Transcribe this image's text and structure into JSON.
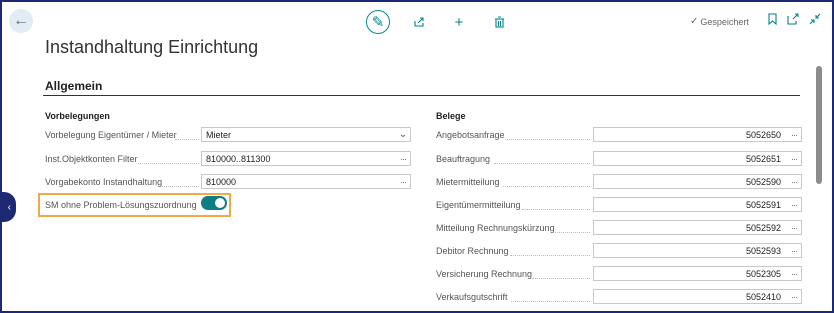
{
  "header": {
    "title": "Instandhaltung Einrichtung",
    "status": "Gespeichert"
  },
  "section": {
    "title": "Allgemein"
  },
  "left_group": {
    "title": "Vorbelegungen",
    "fields": [
      {
        "label": "Vorbelegung Eigentümer / Mieter",
        "value": "Mieter"
      },
      {
        "label": "Inst.Objektkonten Filter",
        "value": "810000..811300"
      },
      {
        "label": "Vorgabekonto Instandhaltung",
        "value": "810000"
      }
    ],
    "toggle": {
      "label": "SM ohne Problem-Lösungszuordnung",
      "state": "on"
    }
  },
  "right_group": {
    "title": "Belege",
    "fields": [
      {
        "label": "Angebotsanfrage",
        "value": "5052650"
      },
      {
        "label": "Beauftragung",
        "value": "5052651"
      },
      {
        "label": "Mietermitteilung",
        "value": "5052590"
      },
      {
        "label": "Eigentümermitteilung",
        "value": "5052591"
      },
      {
        "label": "Mitteilung Rechnungskürzung",
        "value": "5052592"
      },
      {
        "label": "Debitor Rechnung",
        "value": "5052593"
      },
      {
        "label": "Versicherung Rechnung",
        "value": "5052305"
      },
      {
        "label": "Verkaufsgutschrift",
        "value": "5052410"
      }
    ]
  },
  "icons": {
    "back": "arrow-left-icon",
    "edit": "pencil-icon",
    "share": "share-icon",
    "add": "plus-icon",
    "delete": "trash-icon",
    "bookmark": "bookmark-icon",
    "open_new": "open-new-window-icon",
    "collapse": "collapse-icon"
  },
  "colors": {
    "accent": "#008489",
    "frame": "#1d2a73",
    "highlight": "#f2a94a"
  }
}
